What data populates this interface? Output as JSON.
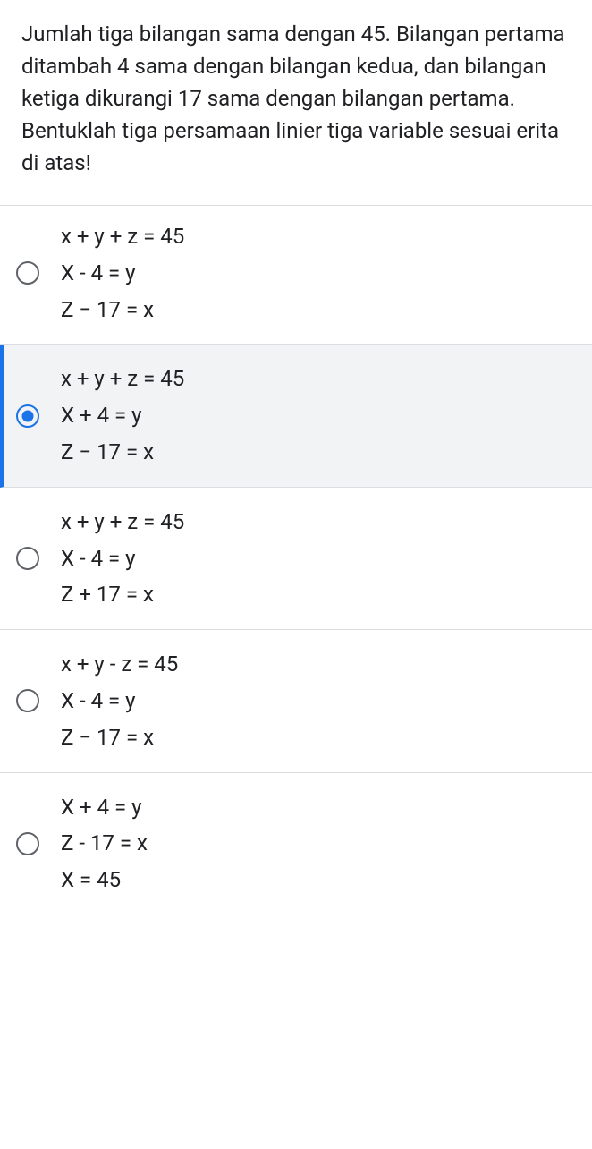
{
  "question": "Jumlah tiga bilangan sama dengan 45. Bilangan pertama ditambah 4 sama dengan bilangan kedua, dan bilangan ketiga dikurangi 17 sama dengan bilangan pertama. Bentuklah tiga persamaan linier tiga variable sesuai erita di atas!",
  "options": [
    {
      "lines": [
        "x + y + z = 45",
        "X - 4 = y",
        "Z − 17 = x"
      ],
      "selected": false
    },
    {
      "lines": [
        "x + y + z = 45",
        "X + 4 = y",
        "Z − 17 = x"
      ],
      "selected": true
    },
    {
      "lines": [
        "x + y + z = 45",
        "X - 4 = y",
        "Z + 17 = x"
      ],
      "selected": false
    },
    {
      "lines": [
        "x + y - z = 45",
        "X - 4 = y",
        "Z − 17 = x"
      ],
      "selected": false
    },
    {
      "lines": [
        "X + 4 = y",
        "Z - 17 = x",
        "X = 45"
      ],
      "selected": false
    }
  ]
}
